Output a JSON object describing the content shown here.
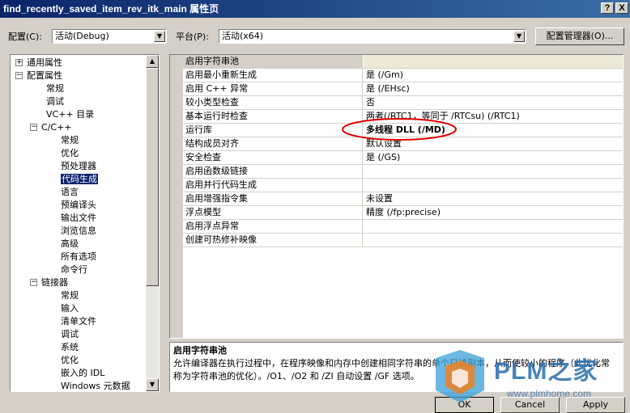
{
  "window": {
    "title": "find_recently_saved_item_rev_itk_main 属性页",
    "help_button": "?",
    "close_button": "X"
  },
  "config": {
    "label": "配置(C):",
    "value": "活动(Debug)"
  },
  "platform": {
    "label": "平台(P):",
    "value": "活动(x64)"
  },
  "config_manager_button": "配置管理器(O)...",
  "tree": {
    "items": [
      {
        "label": "通用属性",
        "expander": "+"
      },
      {
        "label": "配置属性",
        "expander": "−"
      },
      {
        "label": "常规"
      },
      {
        "label": "调试"
      },
      {
        "label": "VC++ 目录"
      },
      {
        "label": "C/C++",
        "expander": "−"
      },
      {
        "label": "常规"
      },
      {
        "label": "优化"
      },
      {
        "label": "预处理器"
      },
      {
        "label": "代码生成"
      },
      {
        "label": "语言"
      },
      {
        "label": "预编译头"
      },
      {
        "label": "输出文件"
      },
      {
        "label": "浏览信息"
      },
      {
        "label": "高级"
      },
      {
        "label": "所有选项"
      },
      {
        "label": "命令行"
      },
      {
        "label": "链接器",
        "expander": "−"
      },
      {
        "label": "常规"
      },
      {
        "label": "输入"
      },
      {
        "label": "清单文件"
      },
      {
        "label": "调试"
      },
      {
        "label": "系统"
      },
      {
        "label": "优化"
      },
      {
        "label": "嵌入的 IDL"
      },
      {
        "label": "Windows 元数据"
      }
    ],
    "selected_index": 9
  },
  "properties": {
    "rows": [
      {
        "name": "启用字符串池",
        "value": ""
      },
      {
        "name": "启用最小重新生成",
        "value": "是 (/Gm)"
      },
      {
        "name": "启用 C++ 异常",
        "value": "是 (/EHsc)"
      },
      {
        "name": "较小类型检查",
        "value": "否"
      },
      {
        "name": "基本运行时检查",
        "value": "两者(/RTC1，等同于 /RTCsu) (/RTC1)"
      },
      {
        "name": "运行库",
        "value": "多线程 DLL (/MD)"
      },
      {
        "name": "结构成员对齐",
        "value": "默认设置"
      },
      {
        "name": "安全检查",
        "value": "是 (/GS)"
      },
      {
        "name": "启用函数级链接",
        "value": ""
      },
      {
        "name": "启用并行代码生成",
        "value": ""
      },
      {
        "name": "启用增强指令集",
        "value": "未设置"
      },
      {
        "name": "浮点模型",
        "value": "精度 (/fp:precise)"
      },
      {
        "name": "启用浮点异常",
        "value": ""
      },
      {
        "name": "创建可热修补映像",
        "value": ""
      }
    ],
    "highlighted_index": 0,
    "bold_index": 5,
    "annotation_color": "#e00000"
  },
  "description": {
    "title": "启用字符串池",
    "line1": "允许编译器在执行过程中，在程序映像和内存中创建相同字符串的单个只读副本，从而使较小的程序（此优化常",
    "line2": "称为字符串池的优化）。/O1、/O2 和 /ZI 自动设置 /GF 选项。"
  },
  "buttons": {
    "ok": "OK",
    "cancel": "Cancel",
    "apply": "Apply"
  },
  "watermark": {
    "brand": "PLM之家",
    "url": "www.plmhome.com"
  }
}
